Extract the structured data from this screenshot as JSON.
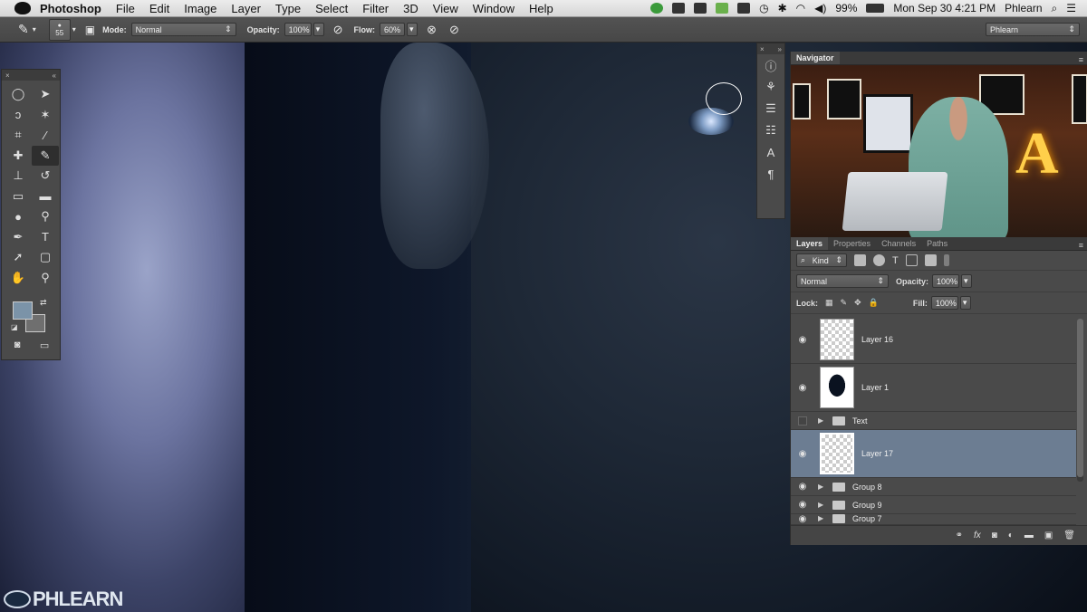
{
  "menubar": {
    "app": "Photoshop",
    "menus": [
      "File",
      "Edit",
      "Image",
      "Layer",
      "Type",
      "Select",
      "Filter",
      "3D",
      "View",
      "Window",
      "Help"
    ],
    "battery": "99%",
    "datetime": "Mon Sep 30  4:21 PM",
    "user": "Phlearn"
  },
  "options": {
    "brush_size": "55",
    "mode_label": "Mode:",
    "mode_value": "Normal",
    "opacity_label": "Opacity:",
    "opacity_value": "100%",
    "flow_label": "Flow:",
    "flow_value": "60%",
    "workspace": "Phlearn"
  },
  "watermark": "PHLEARN",
  "navigator": {
    "title": "Navigator",
    "sign_letter": "A"
  },
  "layers_panel": {
    "tabs": [
      "Layers",
      "Properties",
      "Channels",
      "Paths"
    ],
    "kind_label": "Kind",
    "blend_mode": "Normal",
    "opacity_label": "Opacity:",
    "opacity_value": "100%",
    "lock_label": "Lock:",
    "fill_label": "Fill:",
    "fill_value": "100%",
    "layers": [
      {
        "name": "Layer 16",
        "visible": true
      },
      {
        "name": "Layer 1",
        "visible": true
      },
      {
        "name": "Text",
        "visible": false
      },
      {
        "name": "Layer 17",
        "visible": true,
        "selected": true
      },
      {
        "name": "Group 8",
        "visible": true
      },
      {
        "name": "Group 9",
        "visible": true
      },
      {
        "name": "Group 7",
        "visible": true
      }
    ]
  },
  "colors": {
    "foreground": "#7b93a8",
    "background": "#6f6f6f",
    "selected_layer": "#6c7d92"
  }
}
